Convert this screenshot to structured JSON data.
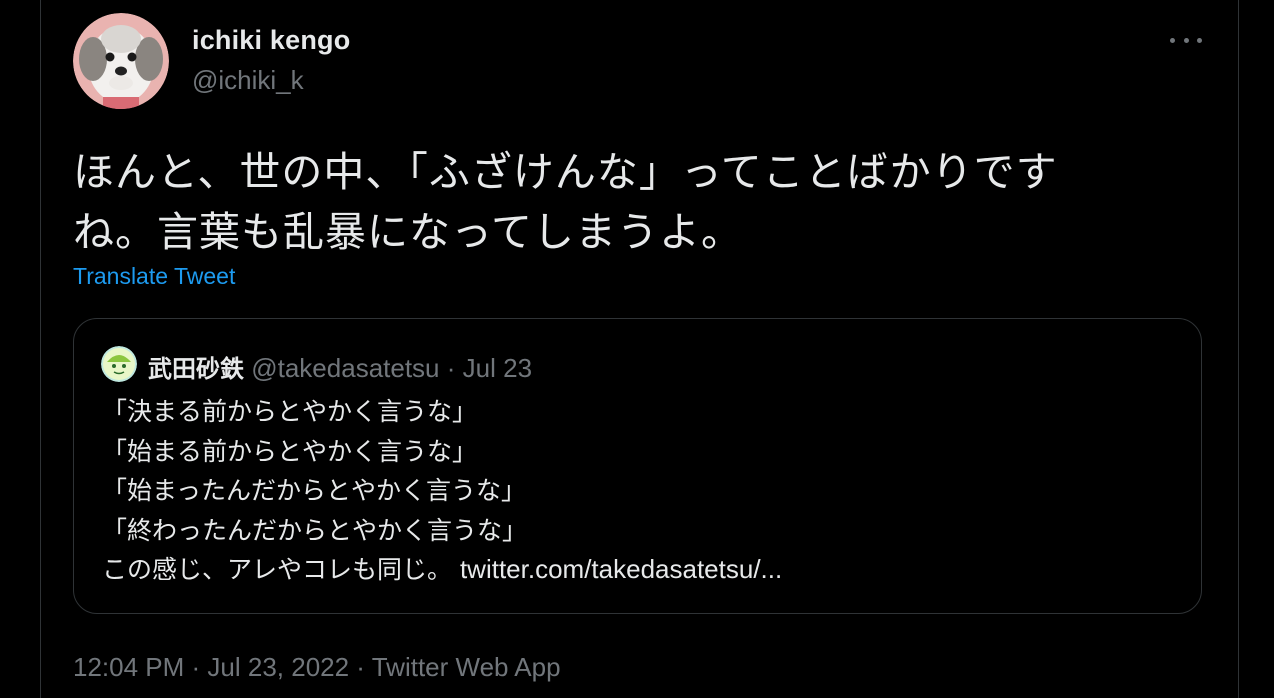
{
  "author": {
    "name": "ichiki kengo",
    "handle": "@ichiki_k"
  },
  "tweet": {
    "line1": "ほんと、世の中、「ふざけんな」ってことばかりです",
    "line2": "ね。言葉も乱暴になってしまうよ。",
    "translate_label": "Translate Tweet"
  },
  "quote": {
    "name": "武田砂鉄",
    "handle": "@takedasatetsu",
    "separator": "·",
    "date": "Jul 23",
    "lines": [
      "「決まる前からとやかく言うな」",
      "「始まる前からとやかく言うな」",
      "「始まったんだからとやかく言うな」",
      "「終わったんだからとやかく言うな」"
    ],
    "last_line_text": "この感じ、アレやコレも同じ。 ",
    "last_line_link": "twitter.com/takedasatetsu/..."
  },
  "meta": {
    "time": "12:04 PM",
    "separator": " · ",
    "date": "Jul 23, 2022",
    "separator2": " · ",
    "app": "Twitter Web App"
  },
  "colors": {
    "background": "#000000",
    "text": "#e7e9ea",
    "secondary": "#71767b",
    "link": "#1d9bf0",
    "border": "#2f3336"
  },
  "icons": {
    "more": "more-horizontal-icon",
    "avatar": "dog-photo-avatar",
    "quote_avatar": "green-character-avatar"
  }
}
